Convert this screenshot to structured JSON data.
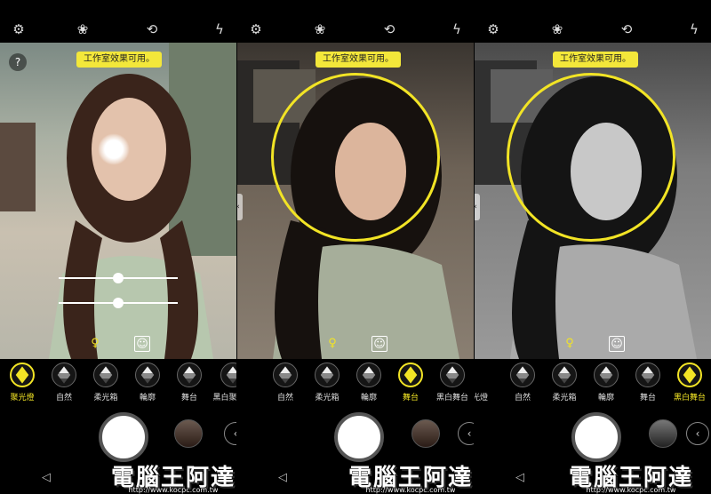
{
  "watermark": {
    "text": "電腦王阿達",
    "url": "http://www.kocpc.com.tw"
  },
  "panels": [
    {
      "notice": "工作室效果可用。",
      "modes": [
        {
          "label": "聚光燈",
          "active": true
        },
        {
          "label": "自然",
          "active": false
        },
        {
          "label": "柔光箱",
          "active": false
        },
        {
          "label": "輪廓",
          "active": false
        },
        {
          "label": "舞台",
          "active": false
        },
        {
          "label": "黑白聚光燈",
          "active": false
        }
      ]
    },
    {
      "notice": "工作室效果可用。",
      "modes": [
        {
          "label": "自然",
          "active": false
        },
        {
          "label": "柔光箱",
          "active": false
        },
        {
          "label": "輪廓",
          "active": false
        },
        {
          "label": "舞台",
          "active": true
        },
        {
          "label": "黑白舞台",
          "active": false
        }
      ]
    },
    {
      "notice": "工作室效果可用。",
      "modes": [
        {
          "label": "光燈",
          "active": false
        },
        {
          "label": "自然",
          "active": false
        },
        {
          "label": "柔光箱",
          "active": false
        },
        {
          "label": "輪廓",
          "active": false
        },
        {
          "label": "舞台",
          "active": false
        },
        {
          "label": "黑白舞台",
          "active": true
        }
      ]
    }
  ],
  "colors": {
    "accent": "#f2e425",
    "background": "#000000"
  },
  "icons": [
    "settings-icon",
    "filter-icon",
    "switch-camera-icon",
    "flash-off-icon",
    "help-icon",
    "bulb-icon",
    "portrait-icon",
    "chevron-left-icon",
    "back-icon"
  ]
}
